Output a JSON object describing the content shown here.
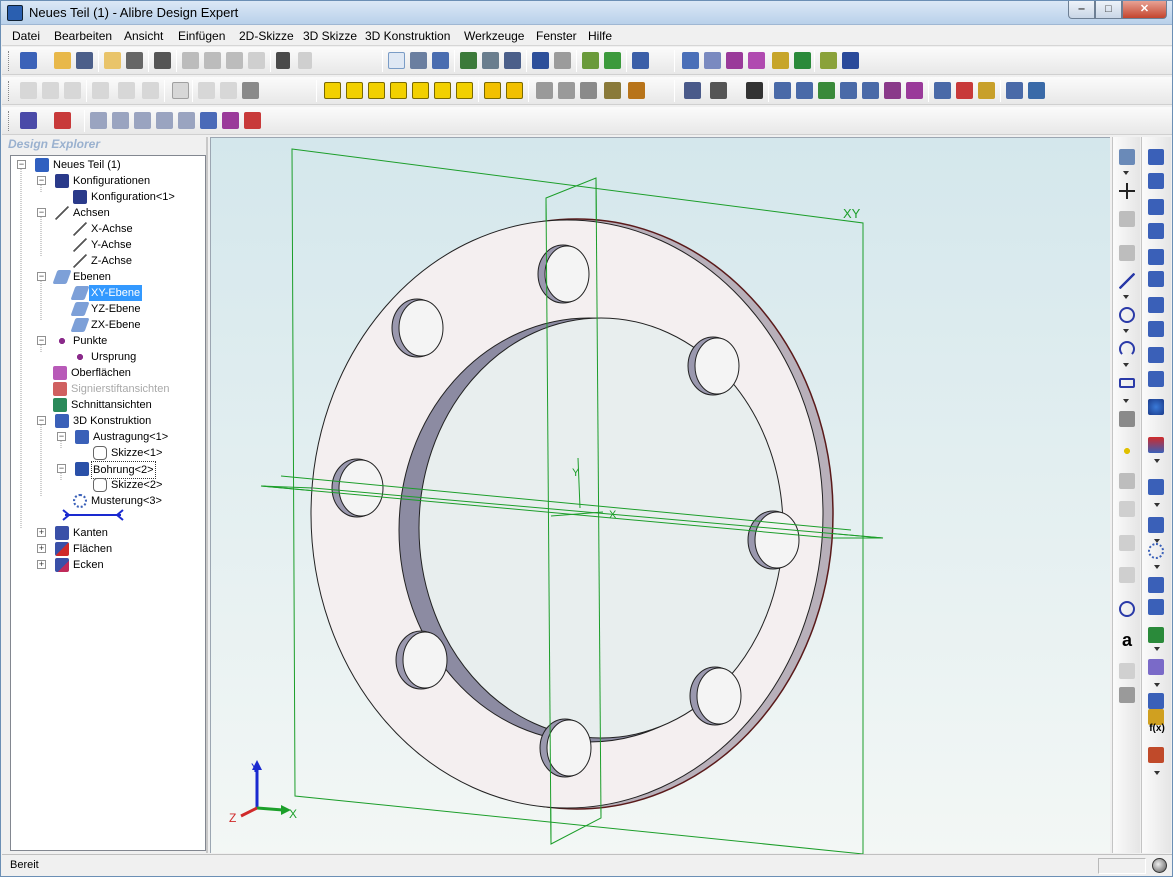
{
  "window": {
    "title": "Neues Teil (1) - Alibre Design Expert",
    "minimize": "‒",
    "maximize": "□",
    "close": "✕"
  },
  "menu": [
    "Datei",
    "Bearbeiten",
    "Ansicht",
    "Einfügen",
    "2D-Skizze",
    "3D Skizze",
    "3D Konstruktion",
    "Werkzeuge",
    "Fenster",
    "Hilfe"
  ],
  "explorer": {
    "header": "Design Explorer",
    "tree": {
      "root": "Neues Teil (1)",
      "konfigurationen": "Konfigurationen",
      "konfiguration1": "Konfiguration<1>",
      "achsen": "Achsen",
      "x_achse": "X-Achse",
      "y_achse": "Y-Achse",
      "z_achse": "Z-Achse",
      "ebenen": "Ebenen",
      "xy_ebene": "XY-Ebene",
      "yz_ebene": "YZ-Ebene",
      "zx_ebene": "ZX-Ebene",
      "punkte": "Punkte",
      "ursprung": "Ursprung",
      "oberflaechen": "Oberflächen",
      "signierstift": "Signierstiftansichten",
      "schnitt": "Schnittansichten",
      "konstruktion": "3D Konstruktion",
      "austragung": "Austragung<1>",
      "skizze1": "Skizze<1>",
      "bohrung": "Bohrung<2>",
      "skizze2": "Skizze<2>",
      "musterung": "Musterung<3>",
      "kanten": "Kanten",
      "flaechen": "Flächen",
      "ecken": "Ecken"
    }
  },
  "viewport": {
    "plane_label": "XY",
    "triad": {
      "x": "X",
      "y": "Y",
      "z": "Z"
    },
    "sketch_x": "X",
    "sketch_y": "Y"
  },
  "right_toolbar": {
    "text_icon": "a",
    "fx_icon": "f(x)"
  },
  "status": {
    "text": "Bereit"
  },
  "colors": {
    "accent": "#3399ff",
    "construction": "#1c9e2a",
    "part_face": "#f3eeef"
  }
}
